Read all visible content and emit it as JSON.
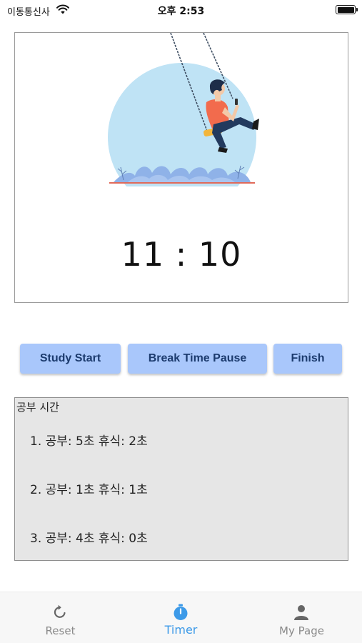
{
  "status_bar": {
    "carrier": "이동통신사",
    "time": "오후 2:53"
  },
  "timer": {
    "display": "11 : 10"
  },
  "buttons": {
    "study_start": "Study Start",
    "break_pause": "Break Time Pause",
    "finish": "Finish"
  },
  "study_log": {
    "title": "공부 시간",
    "items": [
      "1. 공부: 5초  휴식: 2초",
      "2. 공부: 1초  휴식: 1초",
      "3. 공부: 4초  휴식: 0초"
    ]
  },
  "tab_bar": {
    "active_color": "#3d9ae8",
    "inactive_color": "#8a8a8a",
    "tabs": [
      {
        "label": "Reset",
        "icon": "refresh-icon"
      },
      {
        "label": "Timer",
        "icon": "stopwatch-icon"
      },
      {
        "label": "My Page",
        "icon": "person-icon"
      }
    ]
  },
  "colors": {
    "button_bg": "#a9c7fb",
    "button_text": "#1c3b6e",
    "log_bg": "#e6e6e6",
    "illustration_circle": "#bfe3f5"
  }
}
